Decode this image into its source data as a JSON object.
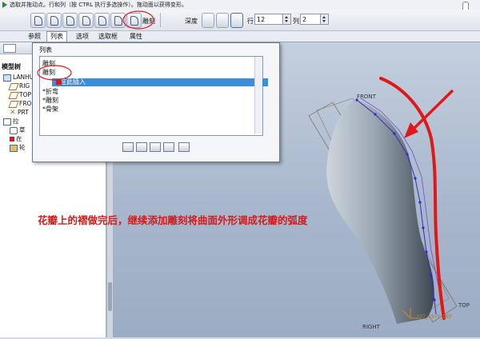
{
  "hint": {
    "text": "选取并拖动点。行和列（按 CTRL 执行多选操作）。拖动面以获得变形。"
  },
  "toolbar": {
    "sculpt_label": "雕刻",
    "depth_label": "深度",
    "row_label": "行",
    "row_value": "12",
    "col_label": "列",
    "col_value": "2"
  },
  "tabs": [
    "参照",
    "列表",
    "选项",
    "选取框",
    "属性"
  ],
  "left_panel": {
    "title": "模型树",
    "items": [
      "LANHUA",
      "RIG",
      "TOP",
      "FRO",
      "PRT",
      "拉",
      "草",
      "在",
      "轮"
    ]
  },
  "list_panel": {
    "title": "列表",
    "items": [
      {
        "label": "雕刻",
        "selected": false
      },
      {
        "label": "雕刻",
        "selected": false
      },
      {
        "label": "在此插入",
        "selected": true
      },
      {
        "label": "*折弯",
        "selected": false
      },
      {
        "label": "*雕刻",
        "selected": false
      },
      {
        "label": "*骨架",
        "selected": false
      }
    ]
  },
  "viewport": {
    "labels": {
      "front": "FRONT",
      "top": "TOP",
      "right": "RIGHT",
      "csys": "PRT_CSYS_DEF"
    }
  },
  "annotation": {
    "caption": "花瓣上的褶做完后，继续添加雕刻将曲面外形调成花瓣的弧度",
    "color": "#e01818"
  }
}
